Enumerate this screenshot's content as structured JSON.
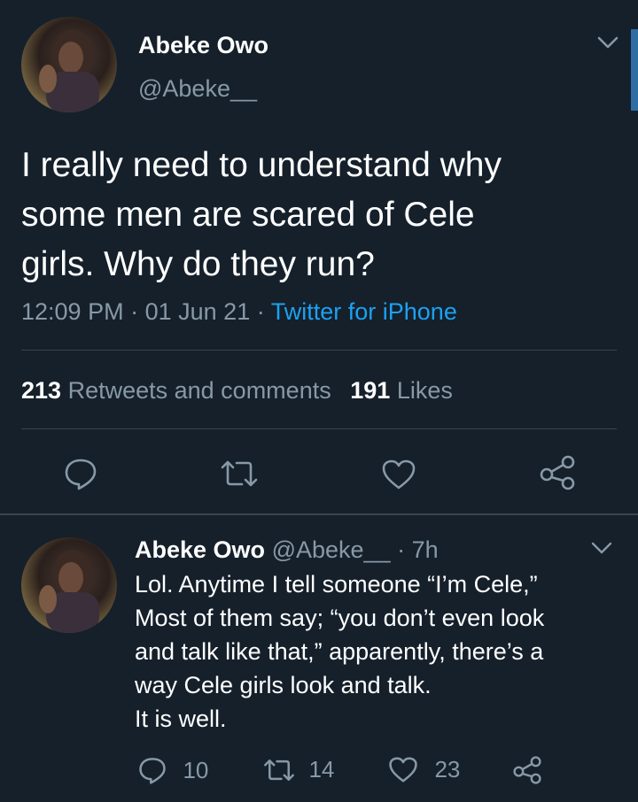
{
  "main_tweet": {
    "author_name": "Abeke Owo",
    "author_handle": "@Abeke__",
    "text_lines": [
      "I really need to understand why",
      "some men are scared of Cele",
      "girls. Why do they run?"
    ],
    "time": "12:09 PM",
    "sep1": "·",
    "date": "01 Jun 21",
    "sep2": "·",
    "source": "Twitter for iPhone",
    "retweets_count": "213",
    "retweets_label": "Retweets and comments",
    "likes_count": "191",
    "likes_label": "Likes"
  },
  "reply": {
    "author_name": "Abeke Owo",
    "author_handle": "@Abeke__",
    "sep": "·",
    "age": "7h",
    "text_lines": [
      "Lol. Anytime I tell someone “I’m Cele,”",
      "Most of them say; “you don’t even look",
      "and talk like that,” apparently, there’s a",
      "way Cele girls look and talk.",
      "It is well."
    ],
    "reply_count": "10",
    "retweet_count": "14",
    "like_count": "23"
  },
  "icons": {
    "chevron": "chevron-down-icon",
    "reply": "reply-icon",
    "retweet": "retweet-icon",
    "like": "heart-icon",
    "share": "share-icon"
  },
  "colors": {
    "background": "#15202b",
    "muted": "#8899a6",
    "link": "#1da1f2",
    "divider": "#38444d"
  }
}
